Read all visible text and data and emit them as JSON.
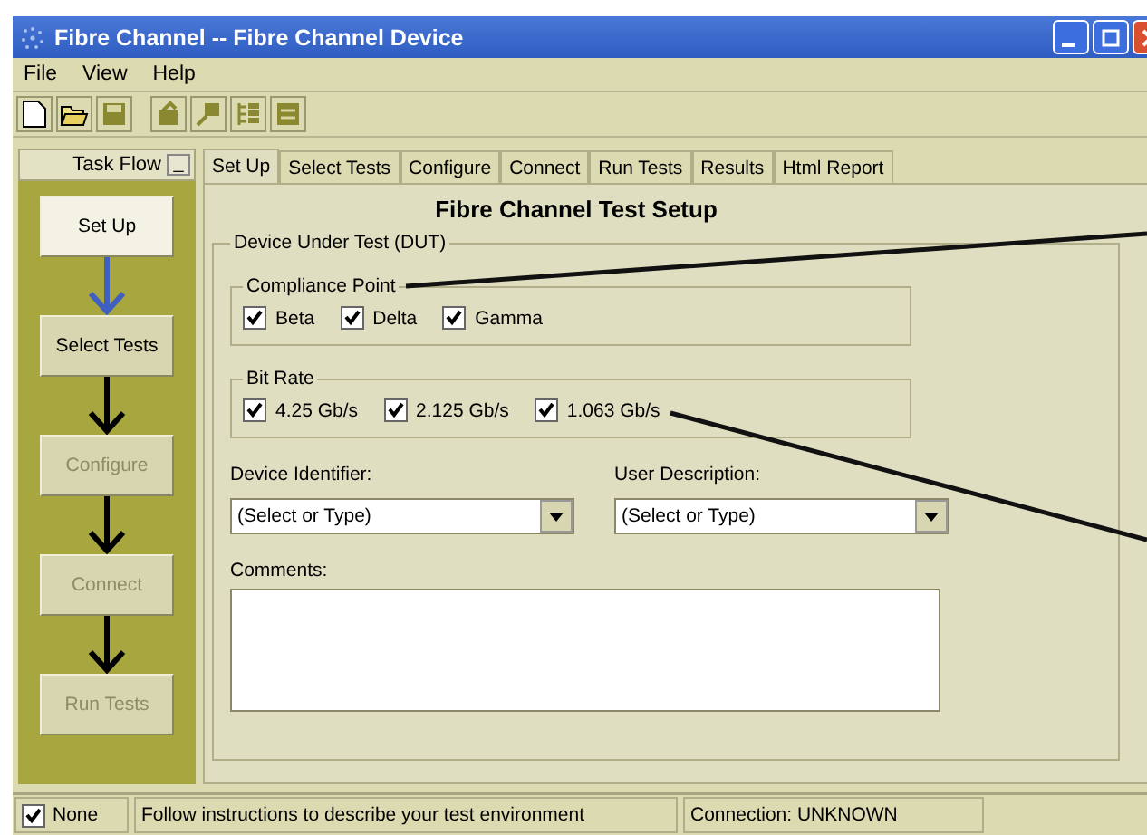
{
  "window": {
    "title": "Fibre Channel -- Fibre Channel Device"
  },
  "menu": [
    "File",
    "View",
    "Help"
  ],
  "task_flow": {
    "title": "Task Flow",
    "minimize": "_",
    "steps": [
      {
        "label": "Set Up",
        "selected": true,
        "disabled": false
      },
      {
        "label": "Select Tests",
        "selected": false,
        "disabled": false
      },
      {
        "label": "Configure",
        "selected": false,
        "disabled": true
      },
      {
        "label": "Connect",
        "selected": false,
        "disabled": true
      },
      {
        "label": "Run Tests",
        "selected": false,
        "disabled": true
      }
    ]
  },
  "tabs": [
    {
      "label": "Set Up",
      "selected": true
    },
    {
      "label": "Select Tests",
      "selected": false
    },
    {
      "label": "Configure",
      "selected": false
    },
    {
      "label": "Connect",
      "selected": false
    },
    {
      "label": "Run Tests",
      "selected": false
    },
    {
      "label": "Results",
      "selected": false
    },
    {
      "label": "Html Report",
      "selected": false
    }
  ],
  "heading": "Fibre Channel Test Setup",
  "dut": {
    "legend": "Device Under Test (DUT)",
    "compliance_point": {
      "legend": "Compliance Point",
      "options": [
        {
          "label": "Beta",
          "checked": true
        },
        {
          "label": "Delta",
          "checked": true
        },
        {
          "label": "Gamma",
          "checked": true
        }
      ]
    },
    "bit_rate": {
      "legend": "Bit Rate",
      "options": [
        {
          "label": "4.25 Gb/s",
          "checked": true
        },
        {
          "label": "2.125 Gb/s",
          "checked": true
        },
        {
          "label": "1.063 Gb/s",
          "checked": true
        }
      ]
    },
    "device_identifier": {
      "label": "Device Identifier:",
      "value": "(Select or Type)"
    },
    "user_description": {
      "label": "User Description:",
      "value": "(Select or Type)"
    },
    "comments": {
      "label": "Comments:"
    }
  },
  "status_bar": {
    "checkbox": {
      "label": "None",
      "checked": true
    },
    "message": "Follow instructions to describe your test environment",
    "connection": "Connection: UNKNOWN"
  }
}
